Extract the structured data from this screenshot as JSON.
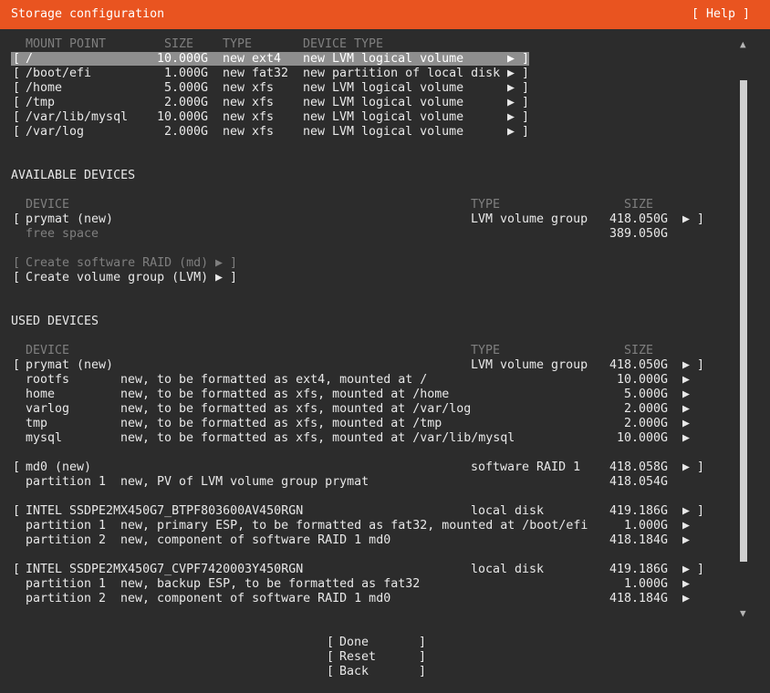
{
  "header": {
    "title": "Storage configuration",
    "help": "[ Help ]"
  },
  "fs_summary": {
    "headers": {
      "mount": "MOUNT POINT",
      "size": "SIZE",
      "type": "TYPE",
      "device_type": "DEVICE TYPE"
    },
    "rows": [
      {
        "mount": "/",
        "size": "10.000G",
        "type": "new ext4",
        "device_type": "new LVM logical volume"
      },
      {
        "mount": "/boot/efi",
        "size": "1.000G",
        "type": "new fat32",
        "device_type": "new partition of local disk"
      },
      {
        "mount": "/home",
        "size": "5.000G",
        "type": "new xfs",
        "device_type": "new LVM logical volume"
      },
      {
        "mount": "/tmp",
        "size": "2.000G",
        "type": "new xfs",
        "device_type": "new LVM logical volume"
      },
      {
        "mount": "/var/lib/mysql",
        "size": "10.000G",
        "type": "new xfs",
        "device_type": "new LVM logical volume"
      },
      {
        "mount": "/var/log",
        "size": "2.000G",
        "type": "new xfs",
        "device_type": "new LVM logical volume"
      }
    ]
  },
  "available": {
    "title": "AVAILABLE DEVICES",
    "headers": {
      "device": "DEVICE",
      "type": "TYPE",
      "size": "SIZE"
    },
    "group": {
      "name": "prymat (new)",
      "type": "LVM volume group",
      "size": "418.050G"
    },
    "free": {
      "label": "free space",
      "size": "389.050G"
    },
    "actions": {
      "raid": "Create software RAID (md)",
      "lvm": "Create volume group (LVM)"
    }
  },
  "used": {
    "title": "USED DEVICES",
    "headers": {
      "device": "DEVICE",
      "type": "TYPE",
      "size": "SIZE"
    },
    "vg": {
      "name": "prymat (new)",
      "type": "LVM volume group",
      "size": "418.050G",
      "children": [
        {
          "name": "rootfs",
          "desc": "new, to be formatted as ext4, mounted at /",
          "size": "10.000G"
        },
        {
          "name": "home",
          "desc": "new, to be formatted as xfs, mounted at /home",
          "size": "5.000G"
        },
        {
          "name": "varlog",
          "desc": "new, to be formatted as xfs, mounted at /var/log",
          "size": "2.000G"
        },
        {
          "name": "tmp",
          "desc": "new, to be formatted as xfs, mounted at /tmp",
          "size": "2.000G"
        },
        {
          "name": "mysql",
          "desc": "new, to be formatted as xfs, mounted at /var/lib/mysql",
          "size": "10.000G"
        }
      ]
    },
    "md": {
      "name": "md0 (new)",
      "type": "software RAID 1",
      "size": "418.058G",
      "children": [
        {
          "name": "partition 1",
          "desc": "new, PV of LVM volume group prymat",
          "size": "418.054G"
        }
      ]
    },
    "disk1": {
      "name": "INTEL SSDPE2MX450G7_BTPF803600AV450RGN",
      "type": "local disk",
      "size": "419.186G",
      "children": [
        {
          "name": "partition 1",
          "desc": "new, primary ESP, to be formatted as fat32, mounted at /boot/efi",
          "size": "1.000G"
        },
        {
          "name": "partition 2",
          "desc": "new, component of software RAID 1 md0",
          "size": "418.184G"
        }
      ]
    },
    "disk2": {
      "name": "INTEL SSDPE2MX450G7_CVPF7420003Y450RGN",
      "type": "local disk",
      "size": "419.186G",
      "children": [
        {
          "name": "partition 1",
          "desc": "new, backup ESP, to be formatted as fat32",
          "size": "1.000G"
        },
        {
          "name": "partition 2",
          "desc": "new, component of software RAID 1 md0",
          "size": "418.184G"
        }
      ]
    }
  },
  "glyphs": {
    "open": "[",
    "close": "]",
    "arrow": "▶",
    "scroll_up": "▲",
    "scroll_down": "▼"
  },
  "buttons": {
    "done": "Done",
    "reset": "Reset",
    "back": "Back"
  },
  "colors": {
    "accent": "#e95420",
    "background": "#2c2c2c",
    "selection": "#8e8e8e",
    "text": "#e8e8e8",
    "dim": "#7f7f7f"
  }
}
